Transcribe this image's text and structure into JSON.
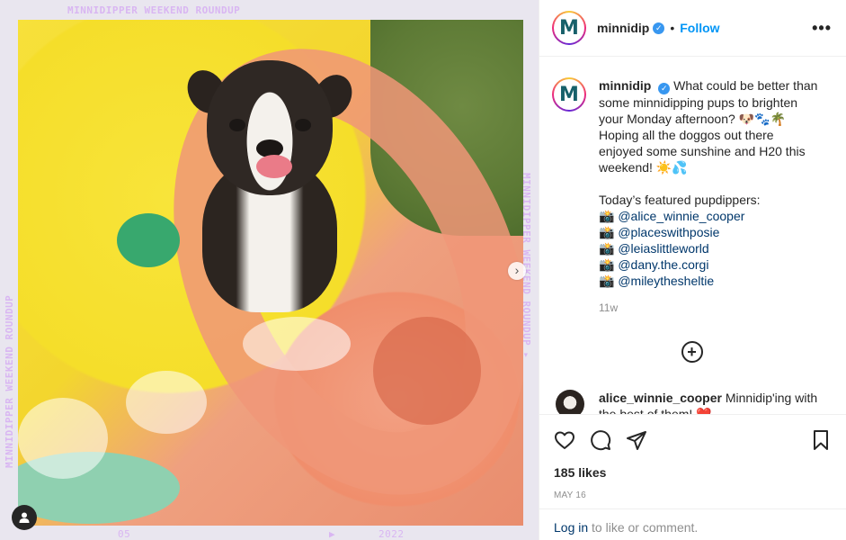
{
  "media": {
    "overlay_top": "MINNIDIPPER WEEKEND ROUNDUP",
    "overlay_left": "MINNIDIPPER WEEKEND ROUNDUP",
    "overlay_right": "MINNIDIPPER WEEKEND ROUNDUP ▸",
    "overlay_bottom_month": "05",
    "overlay_bottom_arrow": "▶",
    "overlay_bottom_year": "2022",
    "next_icon": "chevron-right-icon",
    "user_tag_icon": "person-icon"
  },
  "header": {
    "avatar_letter": "M",
    "username": "minnidip",
    "verified_icon": "✓",
    "separator": "•",
    "follow_label": "Follow",
    "more_label": "•••"
  },
  "caption": {
    "username": "minnidip",
    "line1": " What could be better than some minnidipping pups to brighten your Monday afternoon? 🐶🐾🌴 Hoping all the doggos out there enjoyed some sunshine and H20 this weekend! ☀️💦",
    "featured_label": "Today’s featured pupdippers:",
    "camera": "📸",
    "mentions": [
      "@alice_winnie_cooper",
      "@placeswithposie",
      "@leiaslittleworld",
      "@dany.the.corgi",
      "@mileythesheltie"
    ],
    "time": "11w"
  },
  "comment": {
    "username": "alice_winnie_cooper",
    "text": " Minnidip'ing with the best of them! ❤️"
  },
  "actions": {
    "likes": "185 likes",
    "date": "MAY 16"
  },
  "login": {
    "link": "Log in",
    "rest": " to like or comment."
  }
}
